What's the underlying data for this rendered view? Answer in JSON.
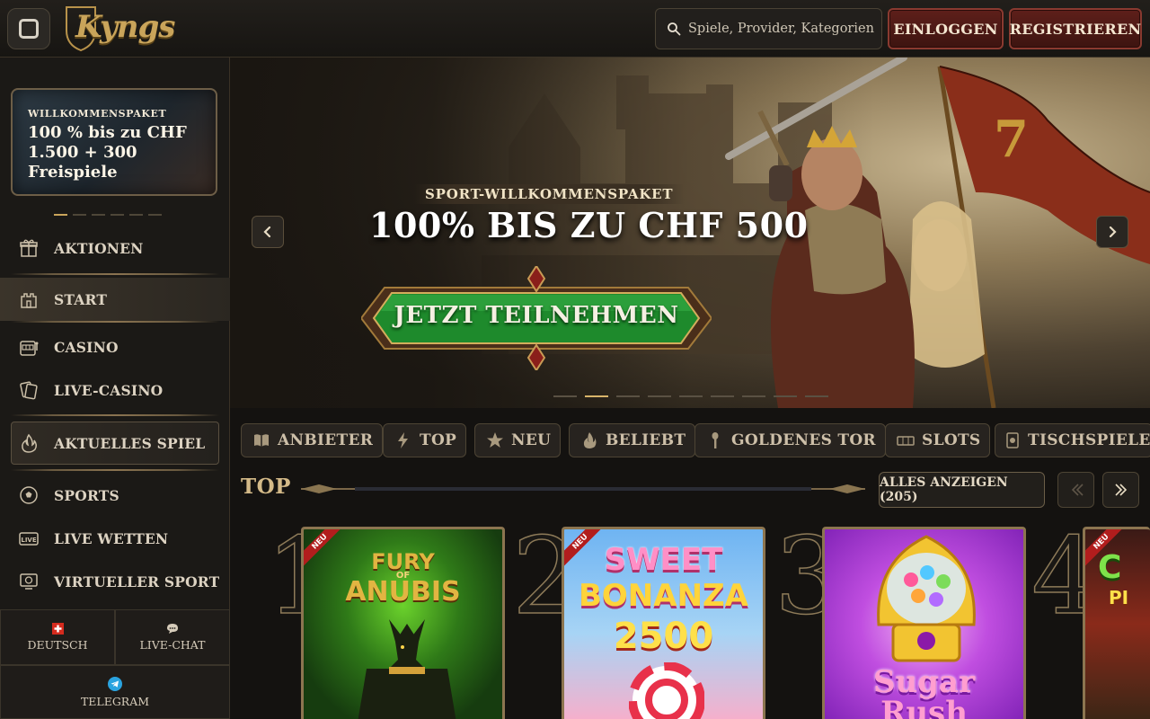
{
  "header": {
    "brand": "Kyngs",
    "search_placeholder": "Spiele, Provider, Kategorien",
    "login_label": "EINLOGGEN",
    "register_label": "REGISTRIEREN"
  },
  "sidebar": {
    "promo": {
      "kicker": "WILLKOMMENSPAKET",
      "text": "100 % bis zu CHF 1.500 + 300 Freispiele"
    },
    "promo_dots": {
      "count": 6,
      "active": 0
    },
    "items": [
      {
        "label": "AKTIONEN",
        "icon": "gift-icon"
      },
      {
        "label": "START",
        "icon": "castle-icon"
      },
      {
        "label": "CASINO",
        "icon": "slot-machine-icon"
      },
      {
        "label": "LIVE-CASINO",
        "icon": "cards-icon"
      },
      {
        "label": "AKTUELLES SPIEL",
        "icon": "flame-icon"
      },
      {
        "label": "SPORTS",
        "icon": "soccer-ball-icon"
      },
      {
        "label": "LIVE WETTEN",
        "icon": "live-icon"
      },
      {
        "label": "VIRTUELLER SPORT",
        "icon": "monitor-ball-icon"
      }
    ],
    "footer": {
      "language": "DEUTSCH",
      "chat": "LIVE-CHAT",
      "telegram": "TELEGRAM"
    }
  },
  "hero": {
    "kicker": "SPORT-WILLKOMMENSPAKET",
    "title": "100% BIS ZU CHF 500",
    "cta": "JETZT TEILNEHMEN",
    "flag_number": "7",
    "dots": {
      "count": 9,
      "active": 1
    }
  },
  "categories": [
    {
      "label": "ANBIETER",
      "icon": "book-icon"
    },
    {
      "label": "TOP",
      "icon": "lightning-icon"
    },
    {
      "label": "NEU",
      "icon": "star-icon"
    },
    {
      "label": "BELIEBT",
      "icon": "flame-icon"
    },
    {
      "label": "GOLDENES TOR",
      "icon": "torch-icon"
    },
    {
      "label": "SLOTS",
      "icon": "slots-icon"
    },
    {
      "label": "TISCHSPIELE",
      "icon": "table-games-icon"
    }
  ],
  "top_section": {
    "title": "TOP",
    "show_all": "ALLES ANZEIGEN (205)",
    "games": [
      {
        "rank": "1",
        "badge": "NEU",
        "name_line1": "FURY",
        "name_small": "OF",
        "name_line2": "ANUBIS"
      },
      {
        "rank": "2",
        "badge": "NEU",
        "name_line1": "SWEET",
        "name_line2": "BONANZA",
        "name_line3": "2500"
      },
      {
        "rank": "3",
        "badge": "",
        "name_line1": "Sugar",
        "name_line2": "Rush"
      },
      {
        "rank": "4",
        "badge": "NEU",
        "name_line1": "C",
        "name_line2": "PI"
      }
    ]
  },
  "colors": {
    "gold": "#c9a45a",
    "button_red": "#5e1f1a",
    "cta_green": "#1e8a2c",
    "background": "#141210"
  }
}
